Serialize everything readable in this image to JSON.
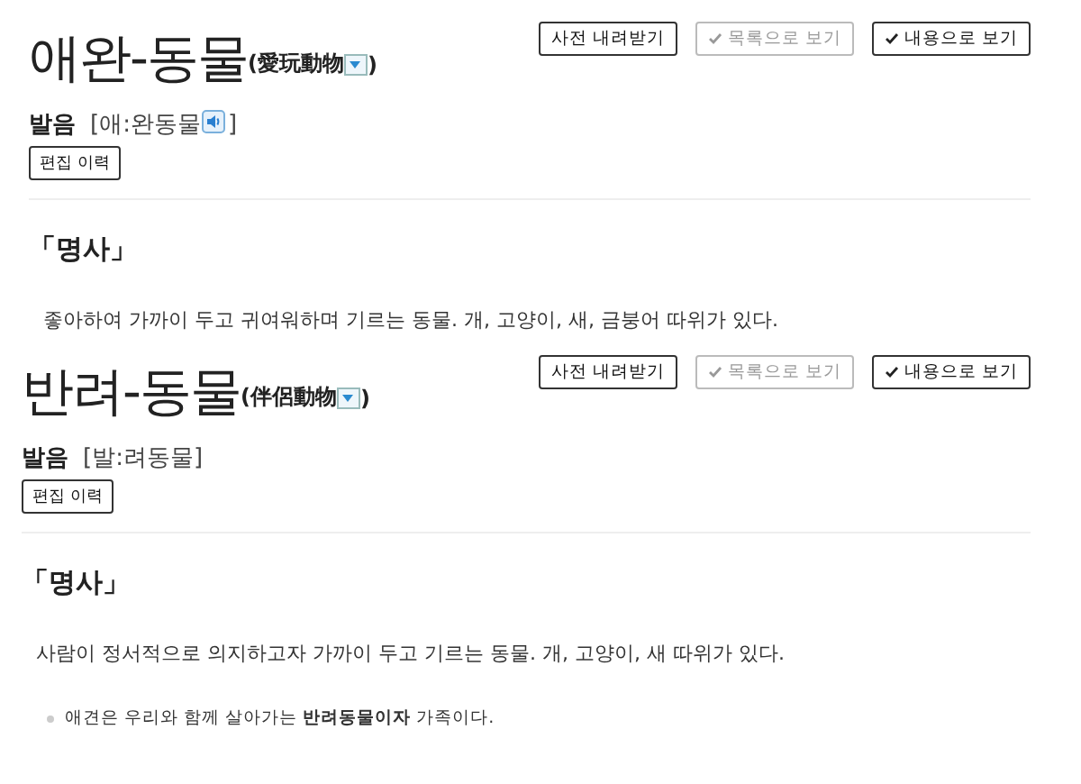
{
  "entries": [
    {
      "headword": "애완-동물",
      "hanja": "(愛玩動物",
      "hanja_end": ")",
      "buttons": [
        {
          "label": "사전 내려받기",
          "kind": "plain"
        },
        {
          "label": "목록으로 보기",
          "kind": "toggle",
          "selected": false
        },
        {
          "label": "내용으로 보기",
          "kind": "toggle",
          "selected": true
        }
      ],
      "pron_label": "발음",
      "pronunciation": "[애:완동물",
      "pronunciation_end": "]",
      "audio": true,
      "history_button": "편집 이력",
      "pos": "「명사」",
      "definition": "좋아하여 가까이 두고 귀여워하며 기르는 동물. 개, 고양이, 새, 금붕어 따위가 있다."
    },
    {
      "headword": "반려-동물",
      "hanja": "(伴侶動物",
      "hanja_end": ")",
      "buttons": [
        {
          "label": "사전 내려받기",
          "kind": "plain"
        },
        {
          "label": "목록으로 보기",
          "kind": "toggle",
          "selected": false
        },
        {
          "label": "내용으로 보기",
          "kind": "toggle",
          "selected": true
        }
      ],
      "pron_label": "발음",
      "pronunciation": "[발:려동물",
      "pronunciation_end": "]",
      "audio": false,
      "history_button": "편집 이력",
      "pos": "「명사」",
      "definition": "사람이 정서적으로 의지하고자 가까이 두고 기르는 동물. 개, 고양이, 새 따위가 있다.",
      "examples": [
        "애견은 우리와 함께 살아가는 **반려동물이자** 가족이다."
      ]
    }
  ]
}
